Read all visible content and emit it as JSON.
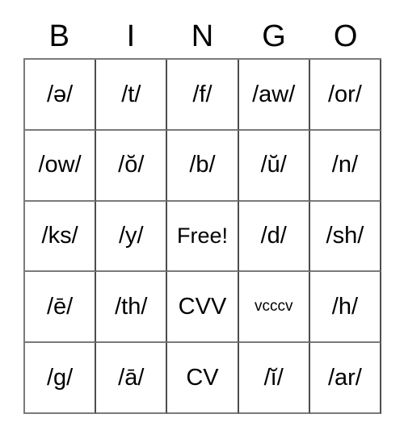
{
  "card": {
    "title": "BINGO",
    "header": {
      "letters": [
        "B",
        "I",
        "N",
        "G",
        "O"
      ]
    },
    "grid": {
      "rows": 5,
      "columns": 5,
      "border_color": "#7a7a7a",
      "background_color": "#ffffff",
      "text_color": "#000000",
      "cells": [
        [
          {
            "text": "/ə/",
            "size": "normal"
          },
          {
            "text": "/t/",
            "size": "normal"
          },
          {
            "text": "/f/",
            "size": "normal"
          },
          {
            "text": "/aw/",
            "size": "normal"
          },
          {
            "text": "/or/",
            "size": "normal"
          }
        ],
        [
          {
            "text": "/ow/",
            "size": "normal"
          },
          {
            "text": "/ŏ/",
            "size": "normal"
          },
          {
            "text": "/b/",
            "size": "normal"
          },
          {
            "text": "/ŭ/",
            "size": "normal"
          },
          {
            "text": "/n/",
            "size": "normal"
          }
        ],
        [
          {
            "text": "/ks/",
            "size": "normal"
          },
          {
            "text": "/y/",
            "size": "normal"
          },
          {
            "text": "Free!",
            "size": "free"
          },
          {
            "text": "/d/",
            "size": "normal"
          },
          {
            "text": "/sh/",
            "size": "normal"
          }
        ],
        [
          {
            "text": "/ē/",
            "size": "normal"
          },
          {
            "text": "/th/",
            "size": "normal"
          },
          {
            "text": "CVV",
            "size": "normal"
          },
          {
            "text": "vcccv",
            "size": "small"
          },
          {
            "text": "/h/",
            "size": "normal"
          }
        ],
        [
          {
            "text": "/g/",
            "size": "normal"
          },
          {
            "text": "/ā/",
            "size": "normal"
          },
          {
            "text": "CV",
            "size": "normal"
          },
          {
            "text": "/ĭ/",
            "size": "normal"
          },
          {
            "text": "/ar/",
            "size": "normal"
          }
        ]
      ]
    }
  }
}
